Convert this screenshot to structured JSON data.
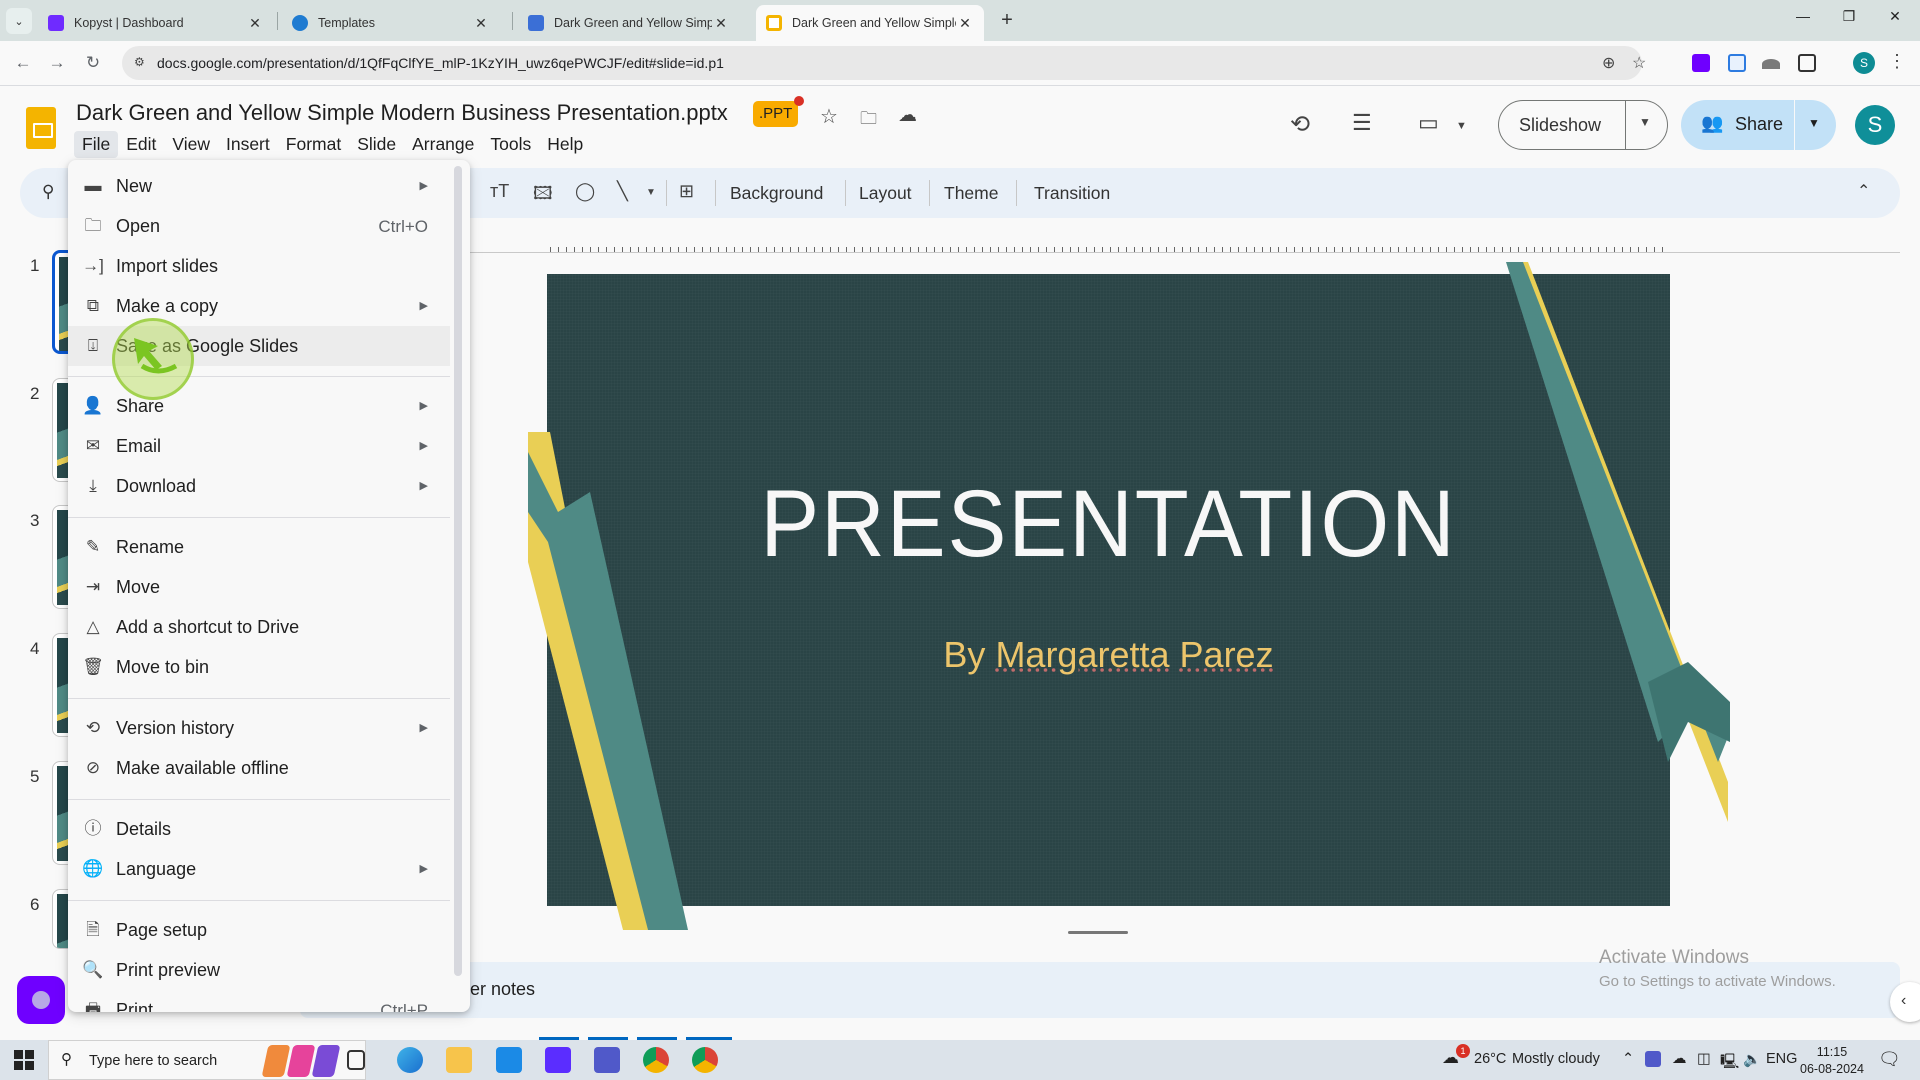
{
  "browser": {
    "tabs": [
      {
        "title": "Kopyst | Dashboard",
        "icon": "kopyst-icon",
        "color": "#6f2bff"
      },
      {
        "title": "Templates",
        "icon": "canva-icon",
        "color": "#1f7bd1"
      },
      {
        "title": "Dark Green and Yellow Simple M",
        "icon": "kopyst-slides-icon",
        "color": "#3b6fd6"
      },
      {
        "title": "Dark Green and Yellow Simple M",
        "icon": "google-slides-icon",
        "color": "#f4b400",
        "active": true
      }
    ],
    "new_tab": "+",
    "controls": {
      "minimize": "—",
      "restore": "❐",
      "close": "✕"
    },
    "url": "docs.google.com/presentation/d/1QfFqClfYE_mlP-1KzYIH_uwz6qePWCJF/edit#slide=id.p1",
    "profile_initial": "S"
  },
  "doc": {
    "title": "Dark Green and Yellow Simple Modern Business Presentation.pptx",
    "badge": ".PPT",
    "menus": [
      "File",
      "Edit",
      "View",
      "Insert",
      "Format",
      "Slide",
      "Arrange",
      "Tools",
      "Help"
    ],
    "open_menu": "File",
    "slideshow_label": "Slideshow",
    "share_label": "Share",
    "avatar_initial": "S",
    "accent_share": "#c2e1f7"
  },
  "toolbar": {
    "buttons": [
      "Background",
      "Layout",
      "Theme",
      "Transition"
    ]
  },
  "file_menu": {
    "items": [
      {
        "label": "New",
        "icon": "new-slides-icon",
        "submenu": true
      },
      {
        "label": "Open",
        "icon": "folder-icon",
        "shortcut": "Ctrl+O"
      },
      {
        "label": "Import slides",
        "icon": "import-icon"
      },
      {
        "label": "Make a copy",
        "icon": "copy-icon",
        "submenu": true
      },
      {
        "label": "Save as Google Slides",
        "icon": "save-download-icon",
        "highlighted": true
      },
      {
        "label": "Share",
        "icon": "person-add-icon",
        "submenu": true
      },
      {
        "label": "Email",
        "icon": "mail-icon",
        "submenu": true
      },
      {
        "label": "Download",
        "icon": "download-icon",
        "submenu": true
      },
      {
        "label": "Rename",
        "icon": "pencil-icon"
      },
      {
        "label": "Move",
        "icon": "move-folder-icon"
      },
      {
        "label": "Add a shortcut to Drive",
        "icon": "drive-shortcut-icon"
      },
      {
        "label": "Move to bin",
        "icon": "trash-icon"
      },
      {
        "label": "Version history",
        "icon": "history-icon",
        "submenu": true
      },
      {
        "label": "Make available offline",
        "icon": "offline-check-icon"
      },
      {
        "label": "Details",
        "icon": "info-icon"
      },
      {
        "label": "Language",
        "icon": "globe-icon",
        "submenu": true
      },
      {
        "label": "Page setup",
        "icon": "page-icon"
      },
      {
        "label": "Print preview",
        "icon": "print-preview-icon"
      },
      {
        "label": "Print",
        "icon": "printer-icon",
        "shortcut": "Ctrl+P"
      }
    ]
  },
  "filmstrip": {
    "slides": [
      "1",
      "2",
      "3",
      "4",
      "5",
      "6"
    ],
    "selected": "1"
  },
  "slide": {
    "title": "PRESENTATION",
    "subtitle_prefix": "By ",
    "subtitle_first": "Margaretta",
    "subtitle_last": "Parez",
    "bg_color": "#2a4446",
    "title_color": "#f7f7f7",
    "subtitle_color": "#edc56b",
    "accent_teal": "#4f8a85",
    "accent_yellow": "#e9cf55"
  },
  "notes": {
    "placeholder_visible": "er notes"
  },
  "watermark": {
    "line1": "Activate Windows",
    "line2": "Go to Settings to activate Windows."
  },
  "taskbar": {
    "search_placeholder": "Type here to search",
    "weather_temp": "26°C",
    "weather_text": "Mostly cloudy",
    "weather_badge": "1",
    "language": "ENG",
    "time": "11:15",
    "date": "06-08-2024"
  }
}
